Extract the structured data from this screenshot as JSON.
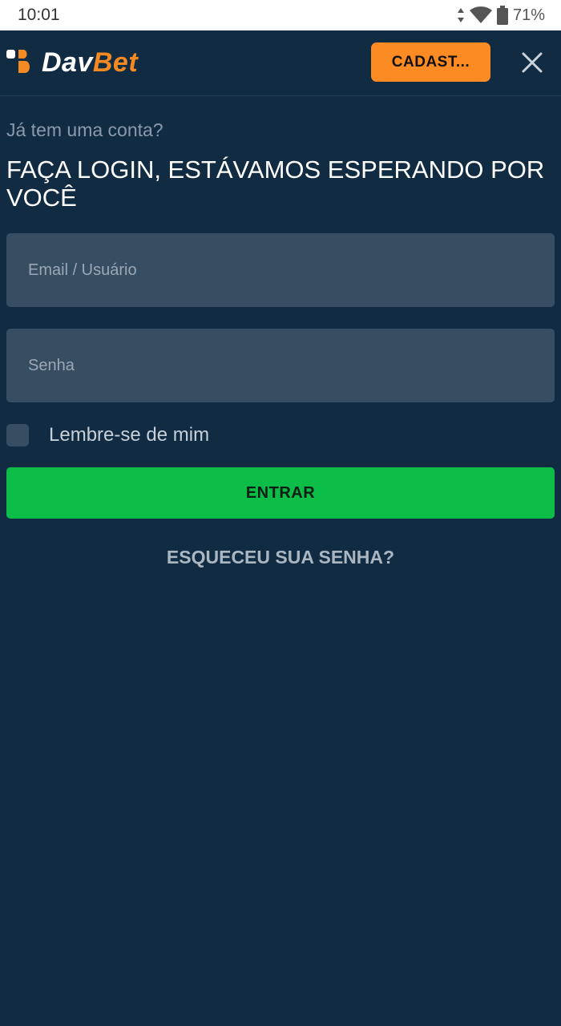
{
  "status_bar": {
    "time": "10:01",
    "battery_percent": "71%",
    "icons": [
      "data-arrows-icon",
      "wifi-icon",
      "battery-icon"
    ]
  },
  "header": {
    "logo": {
      "part1": "Dav",
      "part2": "Bet"
    },
    "signup_label": "CADAST...",
    "close_icon": "close-icon"
  },
  "login": {
    "subtitle": "Já tem uma conta?",
    "headline": "FAÇA LOGIN, ESTÁVAMOS ESPERANDO POR VOCÊ",
    "email_placeholder": "Email / Usuário",
    "email_value": "",
    "password_placeholder": "Senha",
    "password_value": "",
    "remember_label": "Lembre-se de mim",
    "remember_checked": false,
    "submit_label": "ENTRAR",
    "forgot_label": "ESQUECEU SUA SENHA?"
  },
  "colors": {
    "background": "#112c42",
    "field_bg": "#374d62",
    "accent_orange": "#fb8b22",
    "accent_green": "#0cbd48",
    "text_muted": "#8a9aab"
  }
}
